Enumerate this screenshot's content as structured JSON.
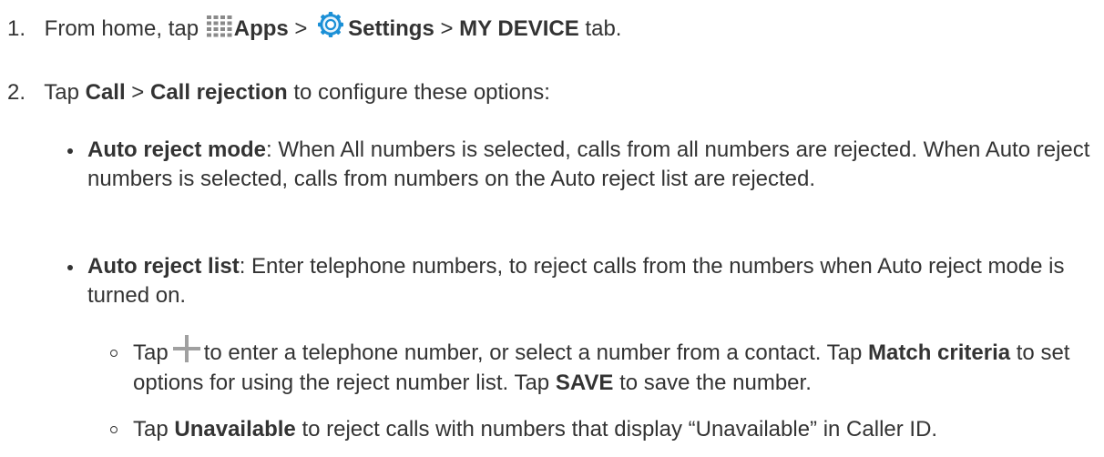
{
  "steps": [
    {
      "number": "1.",
      "parts": {
        "t1": "From home, tap",
        "apps_label": "Apps",
        "t2": ">",
        "settings_label": "Settings",
        "t3": ">",
        "tab_label": "MY DEVICE",
        "t4": "tab."
      }
    },
    {
      "number": "2.",
      "parts": {
        "t1": "Tap",
        "call": "Call",
        "t2": ">",
        "call_rejection": "Call rejection",
        "t3": "to configure these options:"
      }
    }
  ],
  "bullets": [
    {
      "term": "Auto reject mode",
      "text": ": When All numbers is selected, calls from all numbers are rejected. When Auto reject numbers is selected, calls from numbers on the Auto reject list are rejected."
    },
    {
      "term": "Auto reject list",
      "text": ": Enter telephone numbers, to reject calls from the numbers when Auto reject mode is turned on."
    }
  ],
  "subbullets": [
    {
      "t1": "Tap",
      "t2": "to enter a telephone number, or select a number from a contact. Tap",
      "match_criteria": "Match criteria",
      "t3": "to set options for using the reject number list. Tap",
      "save": "SAVE",
      "t4": "to save the number."
    },
    {
      "t1": "Tap",
      "unavailable": "Unavailable",
      "t2": "to reject calls with numbers that display “Unavailable” in Caller ID."
    }
  ],
  "icons": {
    "apps": "apps-grid-icon",
    "settings": "settings-gear-icon",
    "add": "plus-icon"
  },
  "colors": {
    "text": "#333333",
    "settings_icon_blue": "#1a8fd6",
    "plus_icon_gray": "#a0a0a0",
    "apps_icon_gray": "#8a8a8a"
  }
}
